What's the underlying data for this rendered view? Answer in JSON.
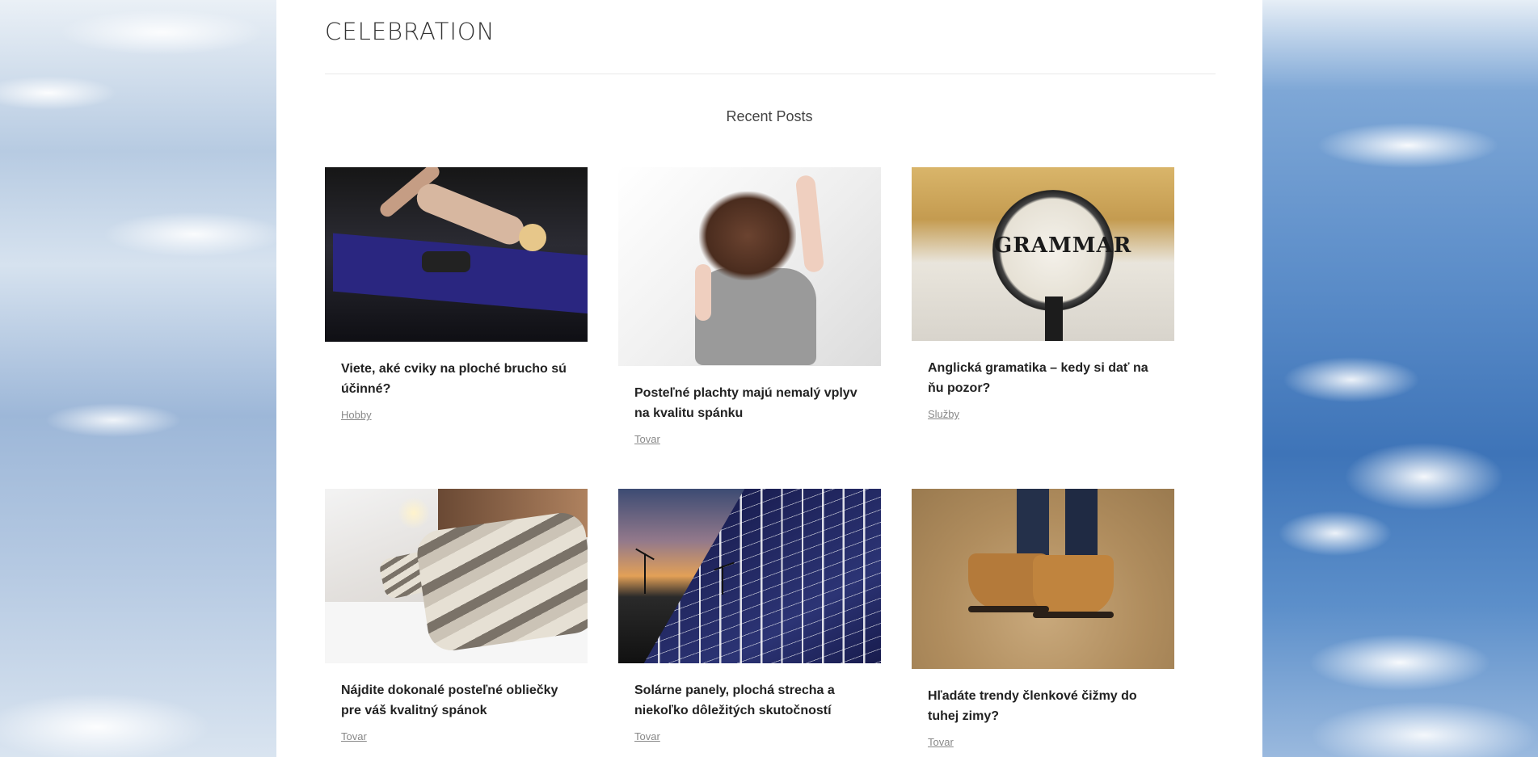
{
  "site": {
    "title": "CELEBRATION"
  },
  "section": {
    "title": "Recent Posts"
  },
  "posts": [
    {
      "title": "Viete, aké cviky na ploché brucho sú účinné?",
      "category": "Hobby",
      "image": "fitness-woman-crunches-photo"
    },
    {
      "title": "Posteľné plachty majú nemalý vplyv na kvalitu spánku",
      "category": "Tovar",
      "image": "woman-sleeping-on-bed-photo"
    },
    {
      "title": "Anglická gramatika – kedy si dať na ňu pozor?",
      "category": "Služby",
      "image": "magnifying-glass-grammar-photo",
      "image_text": "GRAMMAR"
    },
    {
      "title": "Nájdite dokonalé posteľné obliečky pre váš kvalitný spánok",
      "category": "Tovar",
      "image": "striped-pillow-on-bed-photo"
    },
    {
      "title": "Solárne panely, plochá strecha a niekoľko dôležitých skutočností",
      "category": "Tovar",
      "image": "solar-panels-sunset-photo"
    },
    {
      "title": "Hľadáte trendy členkové čižmy do tuhej zimy?",
      "category": "Tovar",
      "image": "ankle-boots-photo"
    }
  ]
}
